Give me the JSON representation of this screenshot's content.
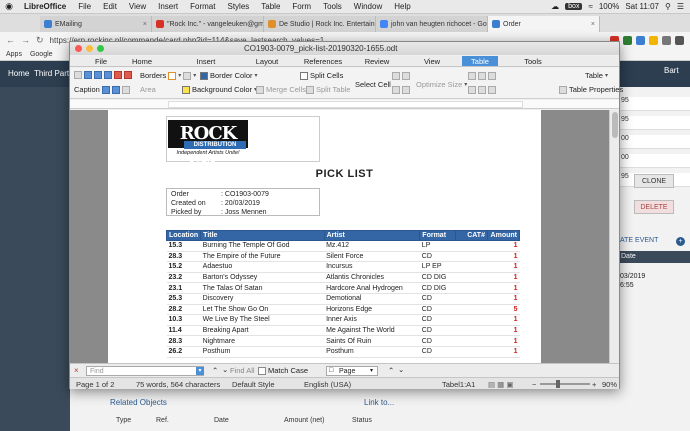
{
  "menubar": {
    "apple": "",
    "app": "LibreOffice",
    "items": [
      "File",
      "Edit",
      "View",
      "Insert",
      "Format",
      "Styles",
      "Table",
      "Form",
      "Tools",
      "Window",
      "Help"
    ],
    "badge": "box",
    "battery": "100%",
    "clock": "Sat 11:07"
  },
  "browser": {
    "tabs": [
      {
        "title": "EMailing",
        "color": "#3c7fd0"
      },
      {
        "title": "\"Rock Inc.\" - vangeleuken@gm",
        "color": "#d93025"
      },
      {
        "title": "De Studio | Rock Inc. Entertain",
        "color": "#e0902a"
      },
      {
        "title": "john van heugten richocet - Go",
        "color": "#4285f4"
      },
      {
        "title": "Order",
        "color": "#3c7fd0"
      }
    ],
    "url": "https://erp.rockinc.nl/commande/card.php?id=114&save_lastsearch_values=1",
    "bookmarks": [
      "Apps",
      "Google"
    ]
  },
  "webapp": {
    "nav": [
      "Home",
      "Third Parties"
    ],
    "user": "Bart",
    "right_cells": [
      "95",
      "95",
      "00",
      "00",
      "95"
    ],
    "clone_label": "CLONE",
    "delete_label": "DELETE",
    "create_event": "ATE EVENT",
    "date_label": "Date",
    "date_value": "03/2019",
    "time_value": "6:55",
    "related": "Related Objects",
    "link_to": "Link to...",
    "related_cols": [
      "Type",
      "Ref.",
      "Date",
      "Amount (net)",
      "Status"
    ]
  },
  "lo": {
    "title": "CO1903-0079_pick-list-20190320-1655.odt",
    "tabs": [
      "File",
      "Home",
      "Insert",
      "Layout",
      "References",
      "Review",
      "View",
      "Table",
      "Tools"
    ],
    "active_tab": "Table",
    "ribbon": {
      "borders": "Borders",
      "border_color": "Border Color",
      "split_cells": "Split Cells",
      "caption": "Caption",
      "area": "Area",
      "background_color": "Background Color",
      "merge_cells": "Merge Cells",
      "split_table": "Split Table",
      "select_cell": "Select Cell",
      "optimize_size": "Optimize Size",
      "table": "Table",
      "table_properties": "Table Properties"
    },
    "doc": {
      "logo_main": "ROCK INC.",
      "logo_sub": "DISTRIBUTION",
      "logo_tag": "Independent Artists Unite!",
      "heading": "PICK LIST",
      "info": [
        {
          "label": "Order",
          "value": ": CO1903-0079"
        },
        {
          "label": "Created on",
          "value": ": 20/03/2019"
        },
        {
          "label": "Picked by",
          "value": ": Joss Mennen"
        }
      ],
      "columns": [
        "Location",
        "Title",
        "Artist",
        "Format",
        "CAT#",
        "Amount"
      ],
      "rows": [
        [
          "15.3",
          "Burning The Temple Of God",
          "Mz.412",
          "LP",
          "",
          "1"
        ],
        [
          "28.3",
          "The Empire of the Future",
          "Silent Force",
          "CD",
          "",
          "1"
        ],
        [
          "15.2",
          "Adaestuo",
          "Incursus",
          "LP EP",
          "",
          "1"
        ],
        [
          "23.2",
          "Barton's Odyssey",
          "Atlantis Chronicles",
          "CD DIG",
          "",
          "1"
        ],
        [
          "23.1",
          "The Talas Of Satan",
          "Hardcore Anal Hydrogen",
          "CD DIG",
          "",
          "1"
        ],
        [
          "25.3",
          "Discovery",
          "Demotional",
          "CD",
          "",
          "1"
        ],
        [
          "28.2",
          "Let The Show Go On",
          "Horizons Edge",
          "CD",
          "",
          "5"
        ],
        [
          "10.3",
          "We Live By The Steel",
          "Inner Axis",
          "CD",
          "",
          "1"
        ],
        [
          "11.4",
          "Breaking Apart",
          "Me Against The World",
          "CD",
          "",
          "1"
        ],
        [
          "28.3",
          "Nightmare",
          "Saints Of Ruin",
          "CD",
          "",
          "1"
        ],
        [
          "26.2",
          "Posthum",
          "Posthum",
          "CD",
          "",
          "1"
        ]
      ]
    },
    "findbar": {
      "placeholder": "Find",
      "find_all": "Find All",
      "match_case": "Match Case",
      "scope": "Page"
    },
    "status": {
      "page": "Page 1 of 2",
      "words": "75 words, 564 characters",
      "style": "Default Style",
      "language": "English (USA)",
      "cell": "Tabel1:A1",
      "zoom": "90%"
    }
  }
}
